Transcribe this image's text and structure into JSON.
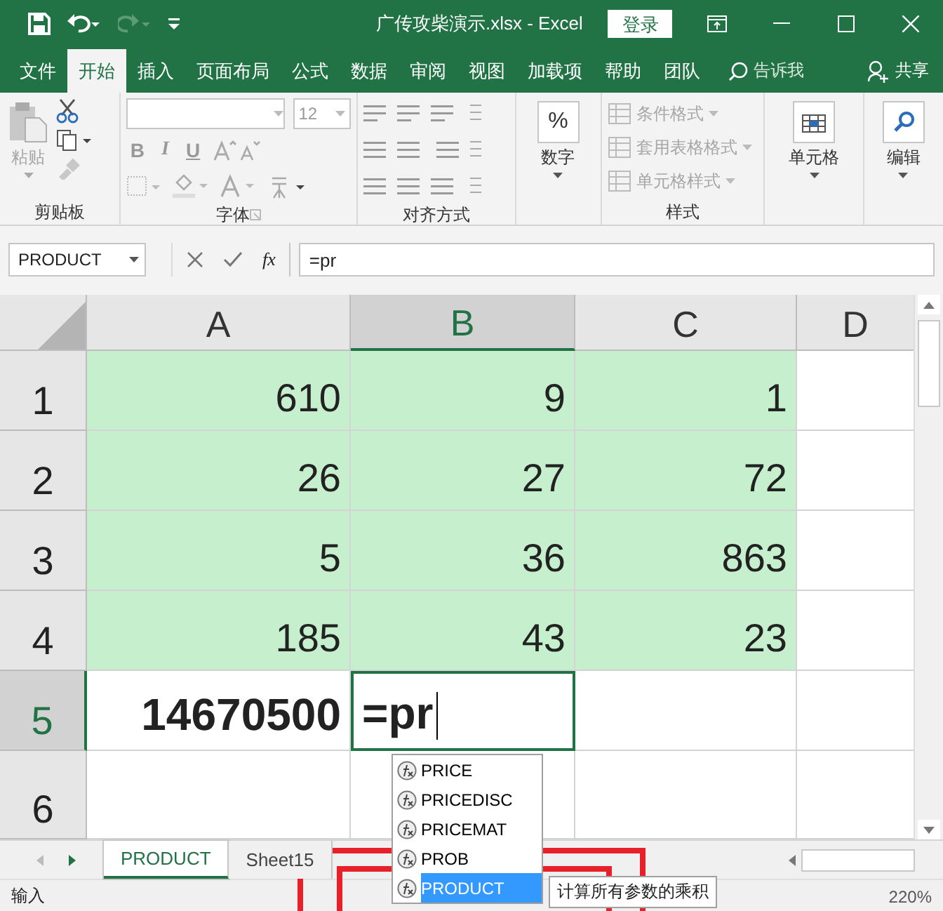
{
  "window": {
    "title": "广传攻柴演示.xlsx  -  Excel",
    "sign_in": "登录"
  },
  "menu_tabs": [
    {
      "label": "文件",
      "selected": false
    },
    {
      "label": "开始",
      "selected": true
    },
    {
      "label": "插入",
      "selected": false
    },
    {
      "label": "页面布局",
      "selected": false
    },
    {
      "label": "公式",
      "selected": false
    },
    {
      "label": "数据",
      "selected": false
    },
    {
      "label": "审阅",
      "selected": false
    },
    {
      "label": "视图",
      "selected": false
    },
    {
      "label": "加载项",
      "selected": false
    },
    {
      "label": "帮助",
      "selected": false
    },
    {
      "label": "团队",
      "selected": false
    }
  ],
  "tell_me": "告诉我",
  "share": "共享",
  "ribbon": {
    "clipboard": {
      "paste": "粘贴",
      "label": "剪贴板"
    },
    "font": {
      "size": "12",
      "bold": "B",
      "italic": "I",
      "underline": "U",
      "label": "字体"
    },
    "alignment": {
      "label": "对齐方式"
    },
    "number": {
      "symbol": "%",
      "button": "数字"
    },
    "styles": {
      "items": [
        {
          "label": "条件格式",
          "disabled": true
        },
        {
          "label": "套用表格格式",
          "disabled": true
        },
        {
          "label": "单元格样式",
          "disabled": true
        }
      ],
      "label": "样式"
    },
    "cells": {
      "button": "单元格"
    },
    "editing": {
      "button": "编辑"
    }
  },
  "formula_bar": {
    "name_box": "PRODUCT",
    "fx": "fx",
    "formula": "=pr"
  },
  "grid": {
    "columns": [
      {
        "label": "A",
        "selected": false
      },
      {
        "label": "B",
        "selected": true
      },
      {
        "label": "C",
        "selected": false
      },
      {
        "label": "D",
        "selected": false
      }
    ],
    "rows": [
      {
        "header": "1",
        "selected": false,
        "cells": [
          {
            "value": "610",
            "highlighted": true
          },
          {
            "value": "9",
            "highlighted": true
          },
          {
            "value": "1",
            "highlighted": true
          }
        ]
      },
      {
        "header": "2",
        "selected": false,
        "cells": [
          {
            "value": "26",
            "highlighted": true
          },
          {
            "value": "27",
            "highlighted": true
          },
          {
            "value": "72",
            "highlighted": true
          }
        ]
      },
      {
        "header": "3",
        "selected": false,
        "cells": [
          {
            "value": "5",
            "highlighted": true
          },
          {
            "value": "36",
            "highlighted": true
          },
          {
            "value": "863",
            "highlighted": true
          }
        ]
      },
      {
        "header": "4",
        "selected": false,
        "cells": [
          {
            "value": "185",
            "highlighted": true
          },
          {
            "value": "43",
            "highlighted": true
          },
          {
            "value": "23",
            "highlighted": true
          }
        ]
      },
      {
        "header": "5",
        "selected": true,
        "cells": [
          {
            "value": "14670500",
            "bold": true
          },
          {
            "value": "=pr",
            "bold": true,
            "editing": true
          }
        ]
      },
      {
        "header": "6",
        "selected": false,
        "cells": []
      }
    ]
  },
  "autocomplete": [
    {
      "label": "PRICE",
      "selected": false
    },
    {
      "label": "PRICEDISC",
      "selected": false
    },
    {
      "label": "PRICEMAT",
      "selected": false
    },
    {
      "label": "PROB",
      "selected": false
    },
    {
      "label": "PRODUCT",
      "selected": true
    }
  ],
  "tooltip": "计算所有参数的乘积",
  "sheet_tabs": [
    {
      "label": "PRODUCT",
      "selected": true
    },
    {
      "label": "Sheet15",
      "selected": false
    }
  ],
  "status_bar": {
    "mode": "输入",
    "zoom": "220%"
  }
}
